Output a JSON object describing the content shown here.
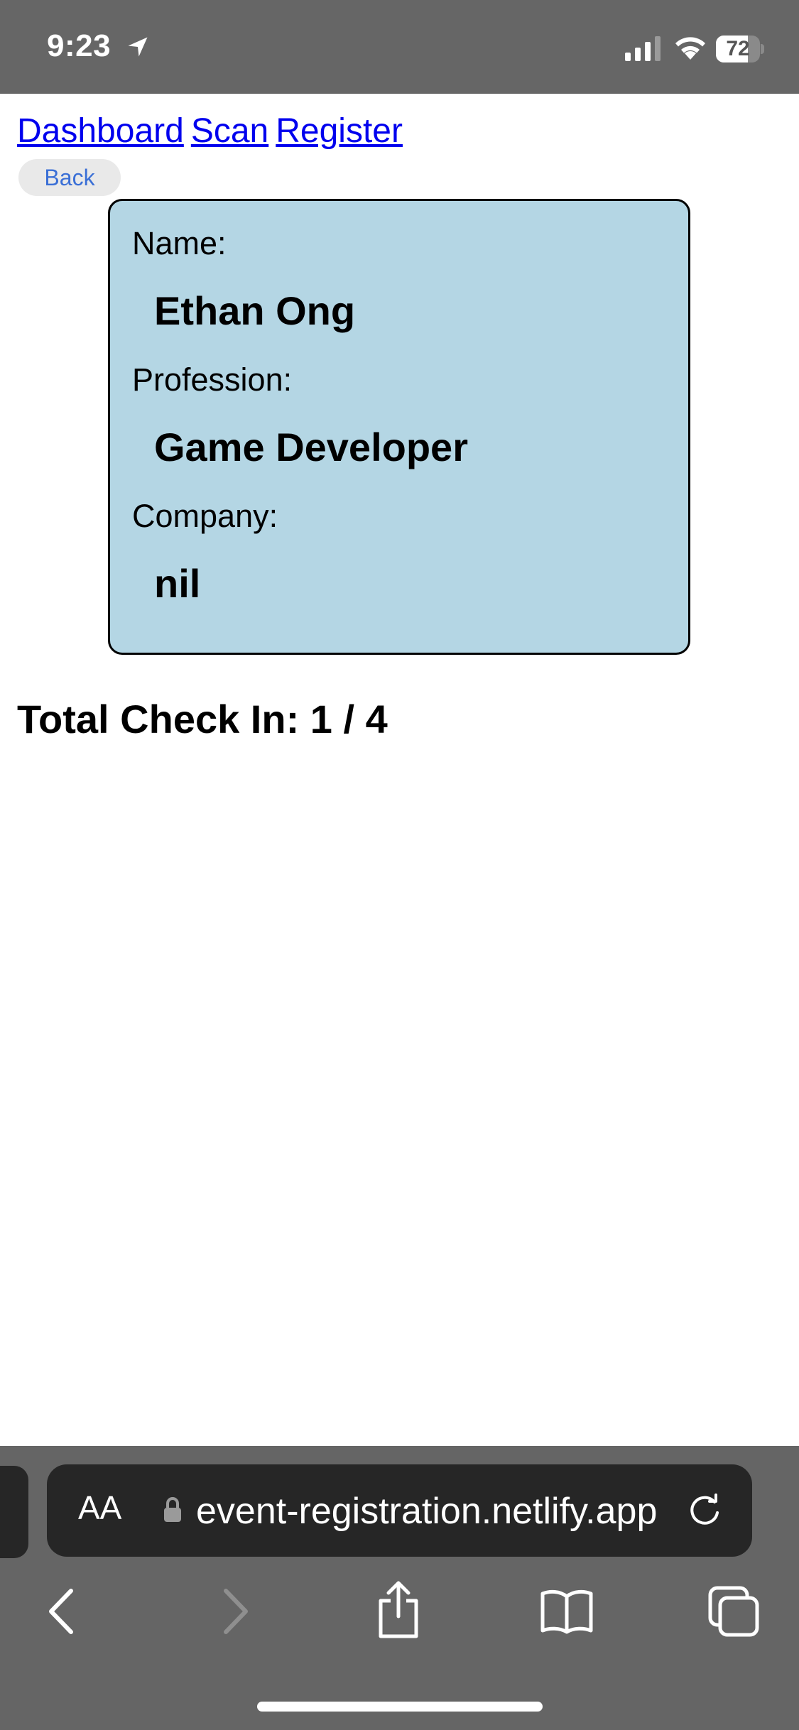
{
  "status_bar": {
    "time": "9:23",
    "battery_level": "72",
    "battery_fraction": 0.72
  },
  "nav": {
    "links": [
      "Dashboard",
      "Scan",
      "Register"
    ]
  },
  "back_label": "Back",
  "attendee": {
    "name_label": "Name:",
    "name": "Ethan Ong",
    "profession_label": "Profession:",
    "profession": "Game Developer",
    "company_label": "Company:",
    "company": "nil"
  },
  "total_check_in": "Total Check In: 1 / 4",
  "browser": {
    "text_size_label": "AA",
    "url": "event-registration.netlify.app"
  },
  "colors": {
    "card_background": "#b4d6e4",
    "link": "#0000ee",
    "back_button_text": "#3a6fd6",
    "chrome_gray": "#656565",
    "address_bar": "#262626"
  },
  "icons": [
    "location-arrow-icon",
    "signal-icon",
    "wifi-icon",
    "battery-icon",
    "lock-icon",
    "reload-icon",
    "back-arrow-icon",
    "forward-arrow-icon",
    "share-icon",
    "bookmarks-icon",
    "tabs-icon"
  ]
}
